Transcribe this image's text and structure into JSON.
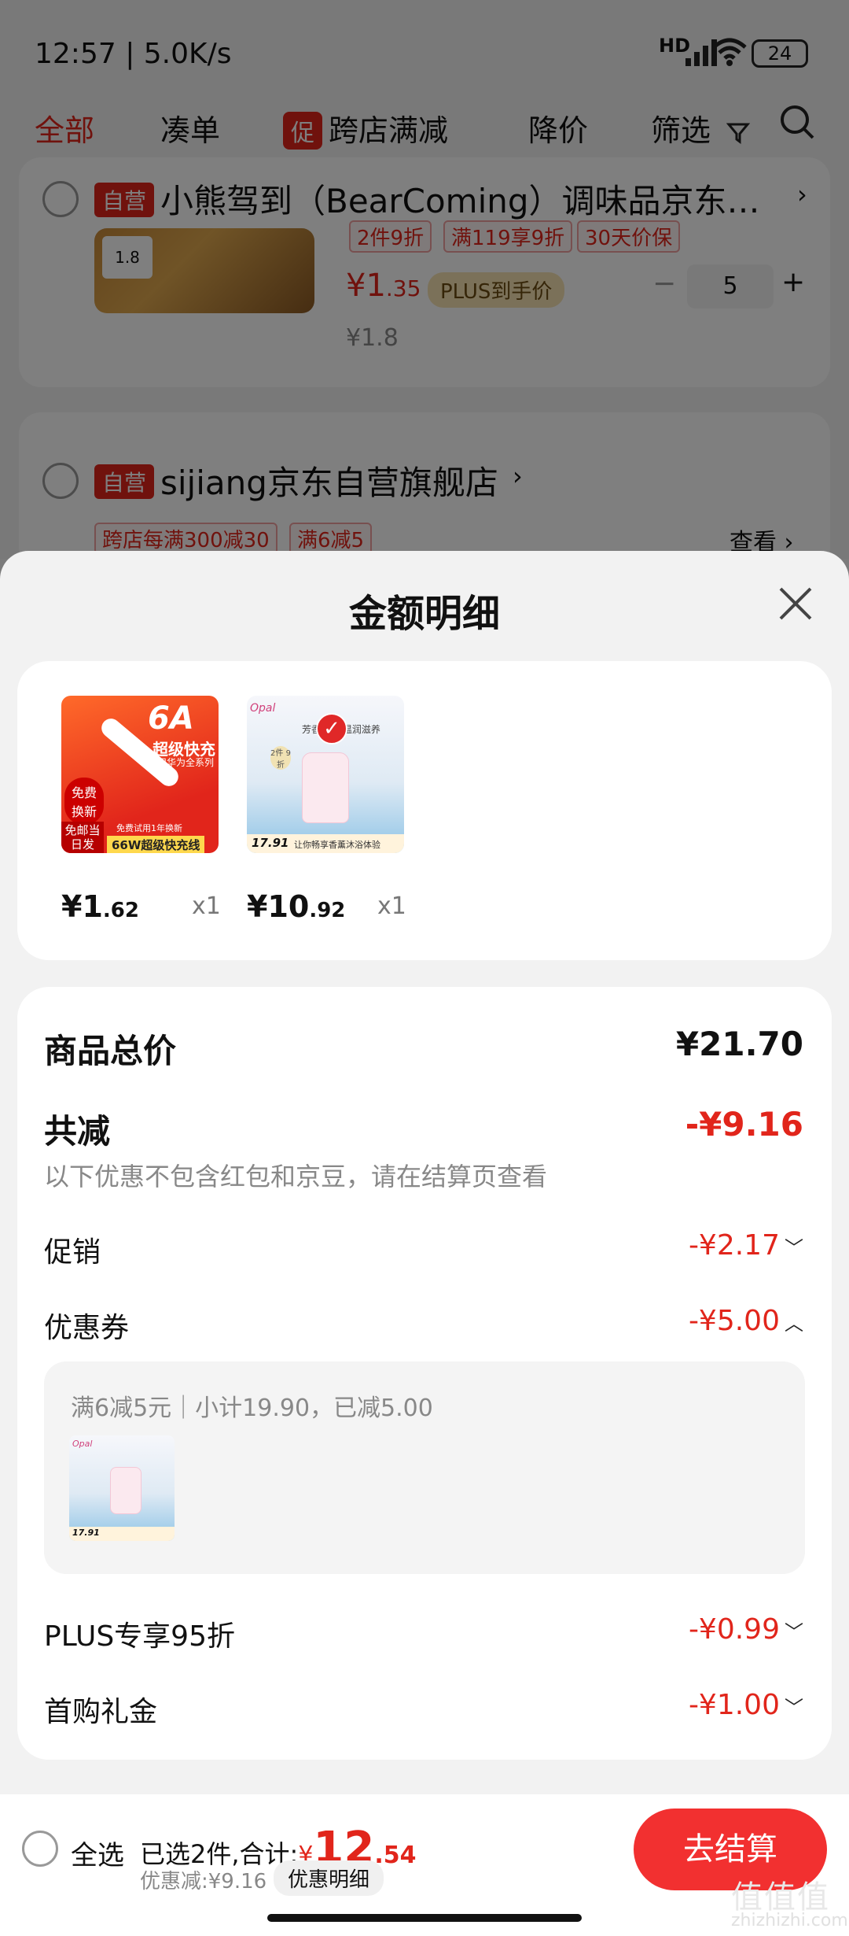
{
  "status_bar": {
    "time": "12:57 | 5.0K/s",
    "signal": "HD",
    "battery": "24"
  },
  "tabs": [
    {
      "label": "全部"
    },
    {
      "label": "凑单"
    },
    {
      "chip": "促",
      "label": "跨店满减"
    },
    {
      "label": "降价"
    },
    {
      "label": "筛选"
    }
  ],
  "bg_store1": {
    "badge": "自营",
    "name": "小熊驾到（BearComing）调味品京东…",
    "tags": [
      "2件9折",
      "满119享9折",
      "30天价保"
    ],
    "price_main": "¥1",
    "price_decimal": ".35",
    "plus_label": "PLUS到手价",
    "orig_price": "¥1.8",
    "qty": "5",
    "minus": "−",
    "plus": "+",
    "thumb_price": "1.8"
  },
  "bg_store2": {
    "badge": "自营",
    "name": "sijiang京东自营旗舰店",
    "tags": [
      "跨店每满300减30",
      "满6减5"
    ],
    "view": "查看"
  },
  "sheet": {
    "title": "金额明细",
    "products": [
      {
        "price_int": "¥1",
        "price_dec": ".62",
        "qty": "x1",
        "img_text": [
          "6A",
          "超级快充",
          "适用华为全系列",
          "免费换新",
          "免邮当日发",
          "66W超级快充线",
          "免费试用1年换新"
        ]
      },
      {
        "price_int": "¥10",
        "price_dec": ".92",
        "qty": "x1",
        "img_text": [
          "芳香润肤 温润滋养",
          "2件 9折",
          "17.91",
          "让你畅享香薰沐浴体验"
        ]
      }
    ],
    "summary": {
      "total_label": "商品总价",
      "total_value": "¥21.70",
      "reduce_label": "共减",
      "reduce_value": "-¥9.16",
      "note": "以下优惠不包含红包和京豆，请在结算页查看",
      "promo_label": "促销",
      "promo_value": "-¥2.17",
      "coupon_label": "优惠券",
      "coupon_value": "-¥5.00",
      "coupon_detail": "满6减5元｜小计19.90，已减5.00",
      "plus_label": "PLUS专享95折",
      "plus_value": "-¥0.99",
      "gift_label": "首购礼金",
      "gift_value": "-¥1.00"
    }
  },
  "bottom": {
    "select_all": "全选",
    "selected_text": "已选2件,合计:",
    "currency": "¥",
    "total_int": "12",
    "total_dec": ".54",
    "discount_text": "优惠减:¥9.16",
    "detail_btn": "优惠明细",
    "checkout": "去结算"
  },
  "watermark": {
    "main": "值值值",
    "sub": "zhizhizhi.com"
  },
  "colors": {
    "accent": "#e1251b",
    "checkout": "#f23030"
  }
}
